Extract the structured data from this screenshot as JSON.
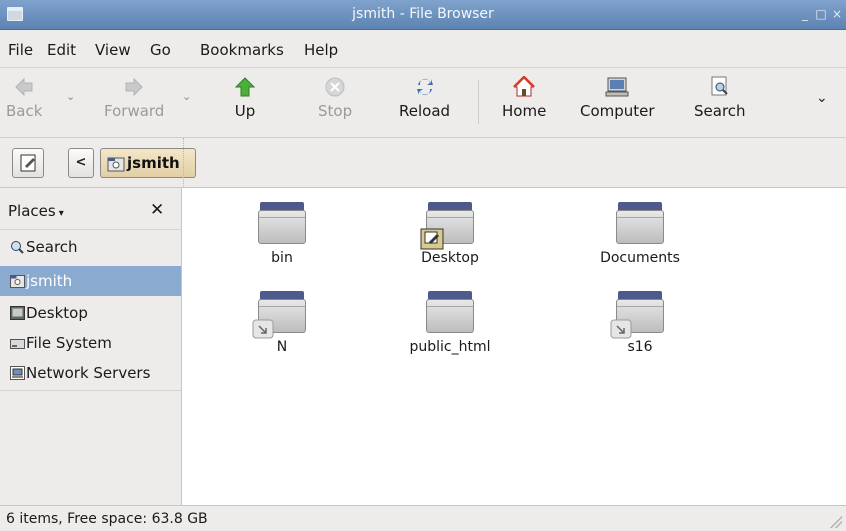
{
  "window": {
    "title": "jsmith - File Browser",
    "minimize": "_",
    "maximize": "□",
    "close": "×"
  },
  "menubar": {
    "items": [
      "File",
      "Edit",
      "View",
      "Go",
      "Bookmarks",
      "Help"
    ]
  },
  "toolbar": {
    "back": "Back",
    "forward": "Forward",
    "up": "Up",
    "stop": "Stop",
    "reload": "Reload",
    "home": "Home",
    "computer": "Computer",
    "search": "Search"
  },
  "location": {
    "back_glyph": "<",
    "crumb": "jsmith"
  },
  "sidebar": {
    "header": "Places",
    "header_arrow": "▾",
    "close": "✕",
    "items": [
      {
        "label": "Search",
        "icon": "search-icon"
      },
      {
        "label": "jsmith",
        "icon": "home-folder-icon",
        "selected": true
      },
      {
        "label": "Desktop",
        "icon": "desktop-icon"
      },
      {
        "label": "File System",
        "icon": "drive-icon"
      },
      {
        "label": "Network Servers",
        "icon": "network-icon"
      }
    ]
  },
  "files": [
    {
      "name": "bin",
      "emblem": ""
    },
    {
      "name": "Desktop",
      "emblem": "desktop-emblem-icon"
    },
    {
      "name": "Documents",
      "emblem": ""
    },
    {
      "name": "N",
      "emblem": "symlink-icon"
    },
    {
      "name": "public_html",
      "emblem": ""
    },
    {
      "name": "s16",
      "emblem": "symlink-icon"
    }
  ],
  "status": {
    "text": "6 items, Free space: 63.8 GB"
  },
  "colors": {
    "titlebar": "#6b8fbd",
    "selection": "#8aaad0",
    "breadcrumb": "#e9d8b2",
    "folder_tab": "#4e5a8c"
  }
}
